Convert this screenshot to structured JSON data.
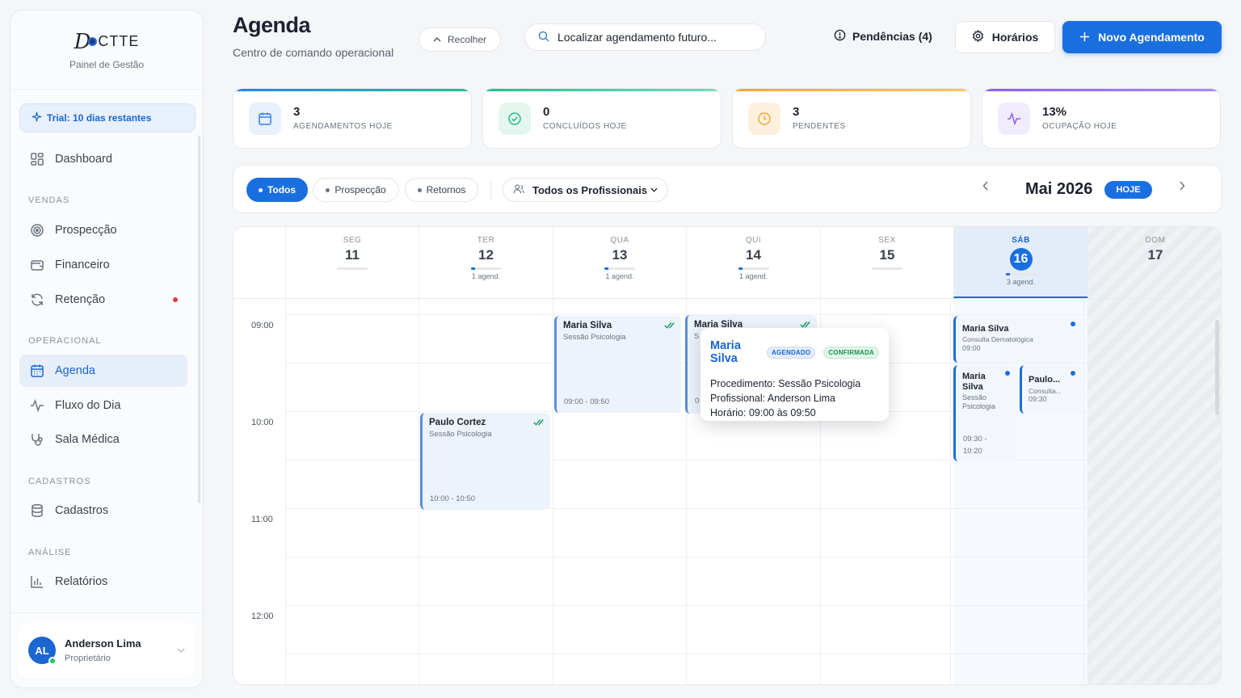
{
  "sidebar": {
    "logo_text": "CTTE",
    "logo_letter": "D",
    "subtitle": "Painel de Gestão",
    "trial": "Trial: 10 dias restantes",
    "sections": {
      "vendas": "VENDAS",
      "operacional": "OPERACIONAL",
      "cadastros": "CADASTROS",
      "analise": "ANÁLISE"
    },
    "items": {
      "dashboard": "Dashboard",
      "prospeccao": "Prospecção",
      "financeiro": "Financeiro",
      "retencao": "Retenção",
      "agenda": "Agenda",
      "fluxo": "Fluxo do Dia",
      "sala": "Sala Médica",
      "cadastros": "Cadastros",
      "relatorios": "Relatórios"
    },
    "user": {
      "initials": "AL",
      "name": "Anderson Lima",
      "role": "Proprietário"
    }
  },
  "header": {
    "title": "Agenda",
    "subtitle": "Centro de comando operacional",
    "collapse": "Recolher",
    "search_placeholder": "Localizar agendamento futuro...",
    "pending": "Pendências (4)",
    "hours": "Horários",
    "new_appointment": "Novo Agendamento"
  },
  "stats": [
    {
      "value": "3",
      "label": "AGENDAMENTOS HOJE",
      "color": "#2f80ed"
    },
    {
      "value": "0",
      "label": "CONCLUÍDOS HOJE",
      "color": "#22c08a"
    },
    {
      "value": "3",
      "label": "PENDENTES",
      "color": "#f2a93b"
    },
    {
      "value": "13%",
      "label": "OCUPAÇÃO HOJE",
      "color": "#8b5cf6"
    }
  ],
  "filters": {
    "all": "Todos",
    "prospect": "Prospecção",
    "returns": "Retornos",
    "professionals": "Todos os Profissionais",
    "month": "Mai 2026",
    "today": "HOJE"
  },
  "calendar": {
    "days": [
      {
        "name": "SEG",
        "num": "11",
        "count": ""
      },
      {
        "name": "TER",
        "num": "12",
        "count": "1 agend."
      },
      {
        "name": "QUA",
        "num": "13",
        "count": "1 agend."
      },
      {
        "name": "QUI",
        "num": "14",
        "count": "1 agend."
      },
      {
        "name": "SEX",
        "num": "15",
        "count": ""
      },
      {
        "name": "SÁB",
        "num": "16",
        "count": "3 agend."
      },
      {
        "name": "DOM",
        "num": "17",
        "count": ""
      }
    ],
    "times": [
      "09:00",
      "10:00",
      "11:00",
      "12:00"
    ],
    "events": {
      "wed": {
        "name": "Maria Silva",
        "proc": "Sessão Psicologia",
        "time": "09:00 - 09:50"
      },
      "thu": {
        "name": "Maria Silva",
        "proc": "S",
        "time": "0"
      },
      "tue": {
        "name": "Paulo Cortez",
        "proc": "Sessão Psicologia",
        "time": "10:00 - 10:50"
      },
      "sat1": {
        "name": "Maria Silva",
        "proc": "Consulta Dematológica",
        "time": "09:00"
      },
      "sat2": {
        "name": "Maria Silva",
        "proc": "Sessão Psicologia",
        "time": "09:30 - 10:20"
      },
      "sat3": {
        "name": "Paulo...",
        "proc": "Consulta...",
        "time": "09:30"
      }
    }
  },
  "popover": {
    "name": "Maria Silva",
    "badge1": "AGENDADO",
    "badge2": "CONFIRMADA",
    "proc_label": "Procedimento:",
    "proc_value": "Sessão Psicologia",
    "prof_label": "Profissional:",
    "prof_value": "Anderson Lima",
    "time_label": "Horário:",
    "time_value": "09:00 às 09:50"
  }
}
